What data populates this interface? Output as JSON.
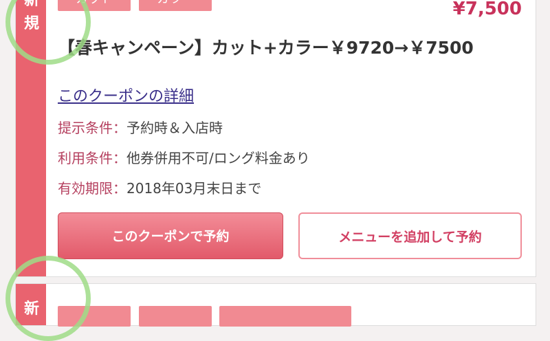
{
  "coupon": {
    "side_label_top": "新規",
    "tags": [
      "カット",
      "カラー"
    ],
    "price": "¥7,500",
    "title": "【春キャンペーン】カット+カラー￥9720→￥7500",
    "detail_link": "このクーポンの詳細",
    "conditions": [
      {
        "label": "提示条件：",
        "value": "予約時＆入店時"
      },
      {
        "label": "利用条件：",
        "value": "他券併用不可/ロング料金あり"
      },
      {
        "label": "有効期限：",
        "value": "2018年03月末日まで"
      }
    ],
    "reserve_button": "このクーポンで予約",
    "add_menu_button": "メニューを追加して予約"
  },
  "next_coupon": {
    "side_label": "新"
  },
  "colors": {
    "accent": "#e9636f",
    "tag_bg": "#f18a92",
    "price": "#c8325b",
    "link": "#3a2f8a"
  }
}
